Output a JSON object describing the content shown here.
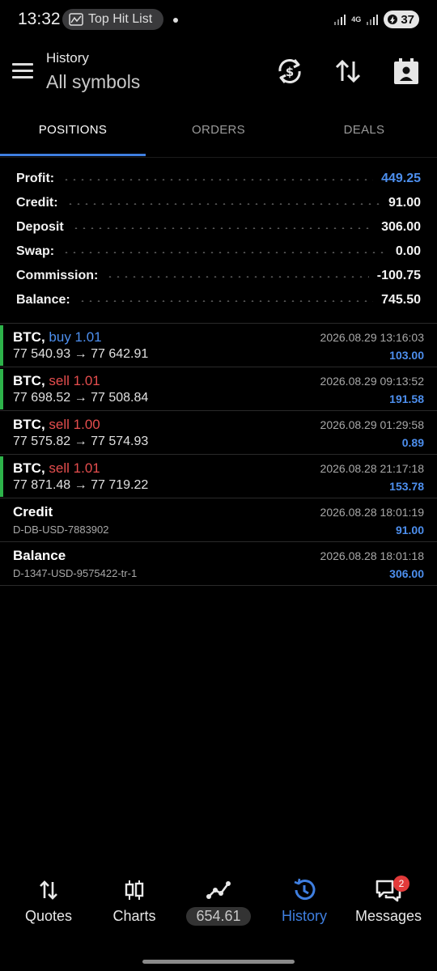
{
  "status_bar": {
    "time": "13:32",
    "notification_pill": "Top Hit List",
    "network": "4G",
    "battery": "37"
  },
  "header": {
    "title": "History",
    "subtitle": "All symbols"
  },
  "tabs": [
    {
      "label": "POSITIONS",
      "active": true
    },
    {
      "label": "ORDERS",
      "active": false
    },
    {
      "label": "DEALS",
      "active": false
    }
  ],
  "summary": [
    {
      "label": "Profit:",
      "value": "449.25",
      "highlight": true
    },
    {
      "label": "Credit:",
      "value": "91.00",
      "highlight": false
    },
    {
      "label": "Deposit",
      "value": "306.00",
      "highlight": false
    },
    {
      "label": "Swap:",
      "value": "0.00",
      "highlight": false
    },
    {
      "label": "Commission:",
      "value": "-100.75",
      "highlight": false
    },
    {
      "label": "Balance:",
      "value": "745.50",
      "highlight": false
    }
  ],
  "positions": [
    {
      "symbol": "BTC,",
      "type": "buy 1.01",
      "side": "buy",
      "prices": "77 540.93 → 77 642.91",
      "date": "2026.08.29 13:16:03",
      "profit": "103.00",
      "marked": true
    },
    {
      "symbol": "BTC,",
      "type": "sell 1.01",
      "side": "sell",
      "prices": "77 698.52 → 77 508.84",
      "date": "2026.08.29 09:13:52",
      "profit": "191.58",
      "marked": true
    },
    {
      "symbol": "BTC,",
      "type": "sell 1.00",
      "side": "sell",
      "prices": "77 575.82 → 77 574.93",
      "date": "2026.08.29 01:29:58",
      "profit": "0.89",
      "marked": false
    },
    {
      "symbol": "BTC,",
      "type": "sell 1.01",
      "side": "sell",
      "prices": "77 871.48 → 77 719.22",
      "date": "2026.08.28 21:17:18",
      "profit": "153.78",
      "marked": true
    }
  ],
  "transfers": [
    {
      "title": "Credit",
      "ref": "D-DB-USD-7883902",
      "date": "2026.08.28 18:01:19",
      "amount": "91.00"
    },
    {
      "title": "Balance",
      "ref": "D-1347-USD-9575422-tr-1",
      "date": "2026.08.28 18:01:18",
      "amount": "306.00"
    }
  ],
  "bottom_nav": [
    {
      "label": "Quotes",
      "icon": "quotes-arrows-icon",
      "active": false
    },
    {
      "label": "Charts",
      "icon": "candlestick-icon",
      "active": false
    },
    {
      "label": "654.61",
      "icon": "trade-line-icon",
      "active": false
    },
    {
      "label": "History",
      "icon": "history-clock-icon",
      "active": true
    },
    {
      "label": "Messages",
      "icon": "messages-icon",
      "active": false,
      "badge": "2"
    }
  ],
  "colors": {
    "accent": "#3f7fe0",
    "profit": "#4d8fee",
    "sell": "#e64e4e",
    "marker": "#2db34a"
  }
}
